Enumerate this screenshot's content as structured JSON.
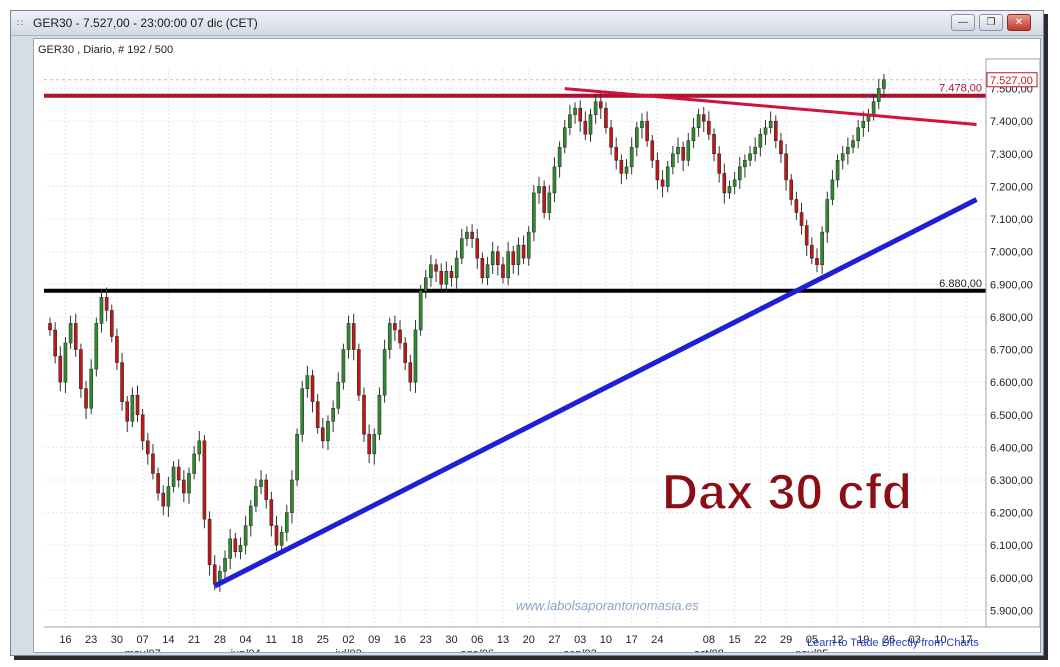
{
  "window": {
    "title": "GER30 - 7.527,00 - 23:00:00  07 dic (CET)",
    "min_icon": "minimize-icon",
    "max_icon": "maximize-icon",
    "close_icon": "close-icon"
  },
  "chart_header": "GER30 , Diario, # 192 / 500",
  "overlay_title": "Dax 30 cfd",
  "watermark": "www.labolsaporantonomasia.es",
  "footer_link": "Learn to Trade Directly from Charts",
  "colors": {
    "up_candle": "#2e8b2e",
    "down_candle": "#c01818",
    "resistance": "#b0102c",
    "support": "#000000",
    "trendline_up": "#1f1fd6",
    "trendline_down": "#d0123c",
    "price_tag": "#c01818"
  },
  "chart_data": {
    "type": "candlestick",
    "ylim": [
      5880,
      7560
    ],
    "y_ticks": [
      "7.500,00",
      "7.400,00",
      "7.300,00",
      "7.200,00",
      "7.100,00",
      "7.000,00",
      "6.900,00",
      "6.800,00",
      "6.700,00",
      "6.600,00",
      "6.500,00",
      "6.400,00",
      "6.300,00",
      "6.200,00",
      "6.100,00",
      "6.000,00",
      "5.900,00"
    ],
    "y_tick_values": [
      7500,
      7400,
      7300,
      7200,
      7100,
      7000,
      6900,
      6800,
      6700,
      6600,
      6500,
      6400,
      6300,
      6200,
      6100,
      6000,
      5900
    ],
    "x_ticks": [
      "16",
      "23",
      "30",
      "07",
      "14",
      "21",
      "28",
      "04",
      "11",
      "18",
      "25",
      "02",
      "09",
      "16",
      "23",
      "30",
      "06",
      "13",
      "20",
      "27",
      "03",
      "10",
      "17",
      "24",
      "08",
      "15",
      "22",
      "29",
      "05",
      "12",
      "19",
      "26",
      "03",
      "10",
      "17"
    ],
    "month_labels": [
      "may/07",
      "jun/04",
      "jul/02",
      "ago/06",
      "sep/03",
      "oct/08",
      "nov/05"
    ],
    "month_label_tick_index": [
      3,
      7,
      11,
      16,
      20,
      24,
      28
    ],
    "x_tick_bar_index": [
      3,
      8,
      13,
      18,
      23,
      28,
      33,
      38,
      43,
      48,
      53,
      58,
      63,
      68,
      73,
      78,
      83,
      88,
      93,
      98,
      103,
      108,
      113,
      118,
      128,
      133,
      138,
      143,
      148,
      153,
      158,
      163,
      168,
      173,
      178
    ],
    "current_price": 7527,
    "current_price_label": "7.527,00",
    "levels": [
      {
        "value": 7478,
        "label": "7.478,00"
      },
      {
        "value": 6880,
        "label": "6.880,00"
      }
    ],
    "trendlines": [
      {
        "name": "uptrend",
        "from": {
          "bar": 32,
          "price": 5975
        },
        "to": {
          "bar": 180,
          "price": 7160
        }
      },
      {
        "name": "downtrend",
        "from": {
          "bar": 100,
          "price": 7500
        },
        "to": {
          "bar": 180,
          "price": 7390
        }
      }
    ],
    "closes": [
      6760,
      6680,
      6600,
      6720,
      6780,
      6700,
      6580,
      6520,
      6640,
      6780,
      6860,
      6820,
      6740,
      6660,
      6540,
      6480,
      6560,
      6500,
      6420,
      6380,
      6320,
      6260,
      6220,
      6280,
      6340,
      6300,
      6260,
      6320,
      6380,
      6420,
      6180,
      6040,
      5980,
      6020,
      6060,
      6120,
      6080,
      6100,
      6160,
      6220,
      6280,
      6300,
      6240,
      6160,
      6100,
      6140,
      6200,
      6300,
      6440,
      6580,
      6620,
      6540,
      6460,
      6420,
      6480,
      6520,
      6600,
      6700,
      6780,
      6700,
      6560,
      6440,
      6380,
      6440,
      6560,
      6700,
      6780,
      6760,
      6720,
      6660,
      6600,
      6760,
      6880,
      6920,
      6960,
      6940,
      6900,
      6940,
      6920,
      6980,
      7040,
      7060,
      7040,
      6980,
      6920,
      6960,
      7000,
      6960,
      6920,
      7000,
      6960,
      7020,
      6980,
      7060,
      7180,
      7200,
      7120,
      7180,
      7260,
      7320,
      7380,
      7420,
      7440,
      7400,
      7360,
      7420,
      7460,
      7440,
      7380,
      7320,
      7280,
      7240,
      7260,
      7320,
      7380,
      7400,
      7340,
      7280,
      7220,
      7200,
      7260,
      7300,
      7320,
      7280,
      7340,
      7380,
      7420,
      7400,
      7360,
      7300,
      7240,
      7180,
      7200,
      7220,
      7260,
      7280,
      7300,
      7320,
      7360,
      7380,
      7400,
      7340,
      7300,
      7220,
      7160,
      7120,
      7080,
      7020,
      6980,
      6960,
      7060,
      7160,
      7220,
      7280,
      7300,
      7320,
      7340,
      7380,
      7400,
      7420,
      7460,
      7500,
      7527
    ]
  }
}
